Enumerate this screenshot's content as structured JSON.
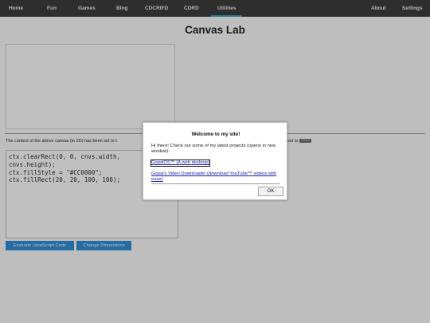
{
  "nav": {
    "items": [
      {
        "label": "Home"
      },
      {
        "label": "Fun"
      },
      {
        "label": "Games"
      },
      {
        "label": "Blog"
      },
      {
        "label": "CDCRIFD"
      },
      {
        "label": "CDRD"
      },
      {
        "label": "Utilities",
        "active": true
      }
    ],
    "right_items": [
      {
        "label": "About"
      },
      {
        "label": "Settings"
      }
    ]
  },
  "page": {
    "title": "Canvas Lab",
    "context_text": "The context of the above canvas (in 2D) has been set to t",
    "context_right_text": "set to",
    "context_var_chip": "cnvs",
    "code": "ctx.clearRect(0, 0, cnvs.width,\ncnvs.height);\nctx.fillStyle = \"#CC0000\";\nctx.fillRect(20, 20, 100, 100);",
    "evaluate_button": "Evaluate JavaScript Code",
    "dimensions_button": "Change Dimensions"
  },
  "dialog": {
    "title": "Welcome to my site!",
    "message": "Hi there! Check out some of my latest projects (opens in new window):",
    "link1": "GopalOS™ (A web desktop)",
    "link2": "Gopal's Video Downloader (download YouTube™ videos with ease)",
    "ok_label": "OK"
  },
  "colors": {
    "nav_bg": "#3b3b3b",
    "accent": "#2a9db8",
    "button_blue": "#2f8bd0",
    "link": "#1a1aa6"
  }
}
